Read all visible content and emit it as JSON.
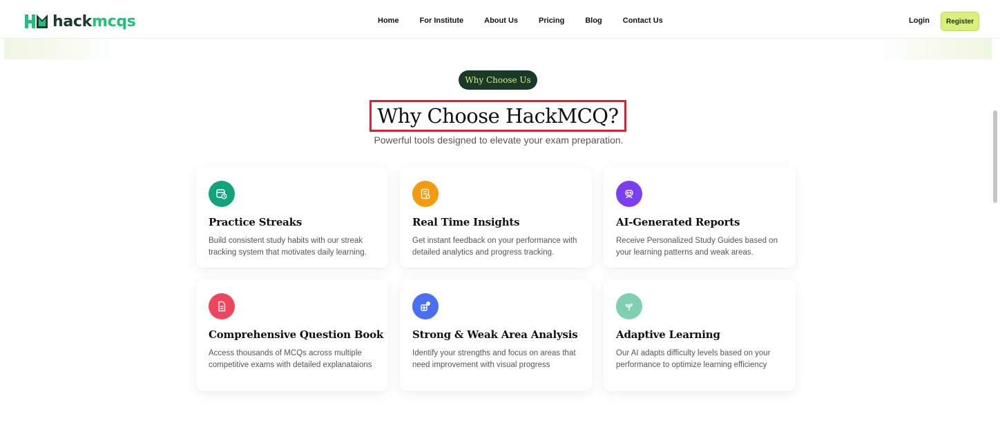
{
  "brand": {
    "name_part1": "hack",
    "name_part2": "mcqs"
  },
  "nav": {
    "items": [
      "Home",
      "For Institute",
      "About Us",
      "Pricing",
      "Blog",
      "Contact Us"
    ],
    "login": "Login",
    "register": "Register"
  },
  "section": {
    "badge": "Why Choose Us",
    "title": "Why Choose HackMCQ?",
    "subtitle": "Powerful tools designed to elevate your exam preparation."
  },
  "features": [
    {
      "title": "Practice Streaks",
      "desc": "Build consistent study habits with our streak tracking system that motivates daily learning.",
      "icon": "calendar-clock-icon",
      "color": "#12a27c"
    },
    {
      "title": "Real Time Insights",
      "desc": "Get instant feedback on your performance with detailed analytics and progress tracking.",
      "icon": "report-icon",
      "color": "#f39a0e"
    },
    {
      "title": "AI-Generated Reports",
      "desc": "Receive Personalized Study Guides based on your learning patterns and weak areas.",
      "icon": "robot-icon",
      "color": "#7a3ff0"
    },
    {
      "title": "Comprehensive Question Book",
      "desc": "Access thousands of MCQs across multiple competitive exams with detailed explanataions",
      "icon": "document-icon",
      "color": "#f0465d"
    },
    {
      "title": "Strong & Weak Area Analysis",
      "desc": "Identify your strengths and focus on areas that need improvement with visual progress",
      "icon": "analysis-icon",
      "color": "#4a6ff2"
    },
    {
      "title": "Adaptive Learning",
      "desc": "Our AI adapts difficulty levels based on your performance to optimize learning efficiency",
      "icon": "sprout-icon",
      "color": "#7fd0b0"
    }
  ]
}
